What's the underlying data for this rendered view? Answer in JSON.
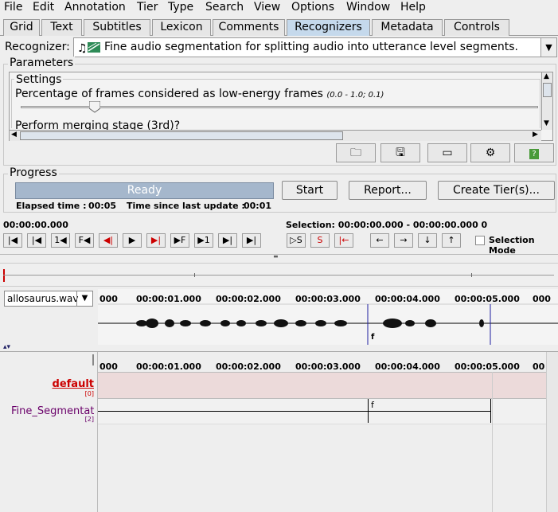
{
  "menu": [
    "File",
    "Edit",
    "Annotation",
    "Tier",
    "Type",
    "Search",
    "View",
    "Options",
    "Window",
    "Help"
  ],
  "tabs": [
    "Grid",
    "Text",
    "Subtitles",
    "Lexicon",
    "Comments",
    "Recognizers",
    "Metadata",
    "Controls"
  ],
  "active_tab": "Recognizers",
  "recognizer": {
    "label": "Recognizer:",
    "selected": "Fine audio segmentation for splitting audio into utterance level segments."
  },
  "parameters": {
    "title": "Parameters",
    "settings_title": "Settings",
    "param1_label": "Percentage of frames considered as low-energy frames",
    "param1_range": "(0.0 - 1.0; 0.1)",
    "param1_value": 0.1,
    "param2_label": "Perform merging stage (3rd)?"
  },
  "progress": {
    "title": "Progress",
    "status": "Ready",
    "elapsed_label": "Elapsed time :",
    "elapsed_value": "00:05",
    "since_label": "Time since last update :",
    "since_value": "00:01",
    "start_button": "Start",
    "report_button": "Report...",
    "create_tiers_button": "Create Tier(s)..."
  },
  "media": {
    "time": "00:00:00.000",
    "selection": "Selection: 00:00:00.000 - 00:00:00.000  0",
    "selection_mode": "Selection Mode",
    "buttons": [
      "|◀",
      "◀|",
      "1◀",
      "F◀",
      "◀|",
      "▶",
      "▶|",
      "▶F",
      "▶1",
      "▶|",
      "▶|"
    ],
    "sel_buttons": [
      "▷S",
      "S",
      "|←"
    ],
    "nav_buttons": [
      "←",
      "→",
      "↓",
      "↑"
    ]
  },
  "waveform": {
    "file": "allosaurus.wav",
    "ruler": [
      "000",
      "00:00:01.000",
      "00:00:02.000",
      "00:00:03.000",
      "00:00:04.000",
      "00:00:05.000",
      "000"
    ],
    "marker": "f"
  },
  "timeline": {
    "ruler": [
      "000",
      "00:00:01.000",
      "00:00:02.000",
      "00:00:03.000",
      "00:00:04.000",
      "00:00:05.000",
      "00"
    ],
    "tiers": [
      {
        "name": "default",
        "count": "[0]",
        "color": "#cc0000"
      },
      {
        "name": "Fine_Segmentati",
        "count": "[2]",
        "color": "#6a006a"
      }
    ],
    "segment_label": "f"
  }
}
